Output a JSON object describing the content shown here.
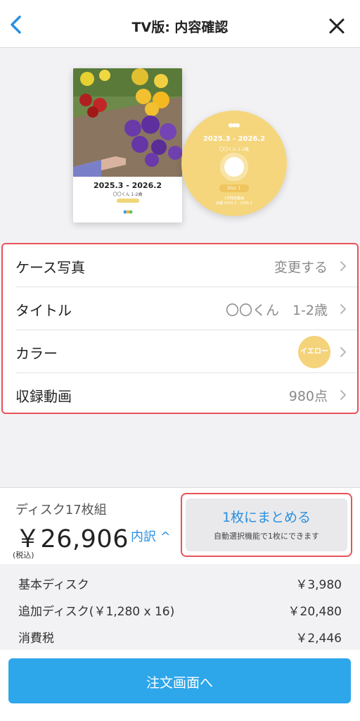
{
  "header": {
    "title": "TV版: 内容確認"
  },
  "preview": {
    "case_title": "2025.3 - 2026.2",
    "case_subtitle": "〇〇くん 1-2歳",
    "disc_title": "2025.3 - 2026.2",
    "disc_subtitle": "〇〇くん 1-2歳",
    "disc_label": "Disc 1",
    "disc_info_1": "1年間総集編",
    "disc_info_2": "収録 2025.3 - 2026.2"
  },
  "settings": {
    "rows": [
      {
        "label": "ケース写真",
        "value": "変更する"
      },
      {
        "label": "タイトル",
        "value": "〇〇くん　1-2歳"
      },
      {
        "label": "カラー",
        "value": "イエロー"
      },
      {
        "label": "収録動画",
        "value": "980点"
      }
    ],
    "color_hex": "#f4d37a"
  },
  "summary": {
    "disc_count": "ディスク17枚組",
    "price": "￥26,906",
    "breakdown_link": "内訳 ^",
    "tax_note": "(税込)",
    "merge_button_label": "1枚にまとめる",
    "merge_button_sub": "自動選択機能で1枚にできます"
  },
  "breakdown": [
    {
      "label": "基本ディスク",
      "value": "￥3,980"
    },
    {
      "label": "追加ディスク(￥1,280 x 16)",
      "value": "￥20,480"
    },
    {
      "label": "消費税",
      "value": "￥2,446"
    }
  ],
  "cta": {
    "label": "注文画面へ"
  },
  "colors": {
    "accent": "#2ea6ea",
    "highlight_border": "#e8525a",
    "link": "#2a8fe0",
    "disc_yellow": "#f5d67d"
  }
}
